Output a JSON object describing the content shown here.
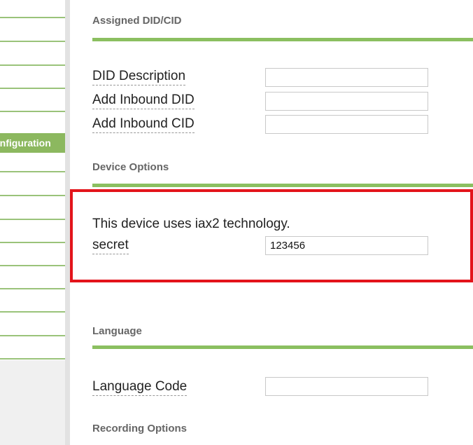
{
  "sidebar": {
    "active_item_label": "Configuration"
  },
  "sections": {
    "assigned_did_cid": {
      "title": "Assigned DID/CID",
      "fields": {
        "did_description": {
          "label": "DID Description",
          "value": ""
        },
        "add_inbound_did": {
          "label": "Add Inbound DID",
          "value": ""
        },
        "add_inbound_cid": {
          "label": "Add Inbound CID",
          "value": ""
        }
      }
    },
    "device_options": {
      "title": "Device Options",
      "technology_text": "This device uses iax2 technology.",
      "secret": {
        "label": "secret",
        "value": "123456"
      }
    },
    "language": {
      "title": "Language",
      "language_code": {
        "label": "Language Code",
        "value": ""
      }
    },
    "recording_options": {
      "title": "Recording Options"
    }
  },
  "colors": {
    "accent_green": "#8bbf60",
    "highlight_red": "#e3141b"
  }
}
